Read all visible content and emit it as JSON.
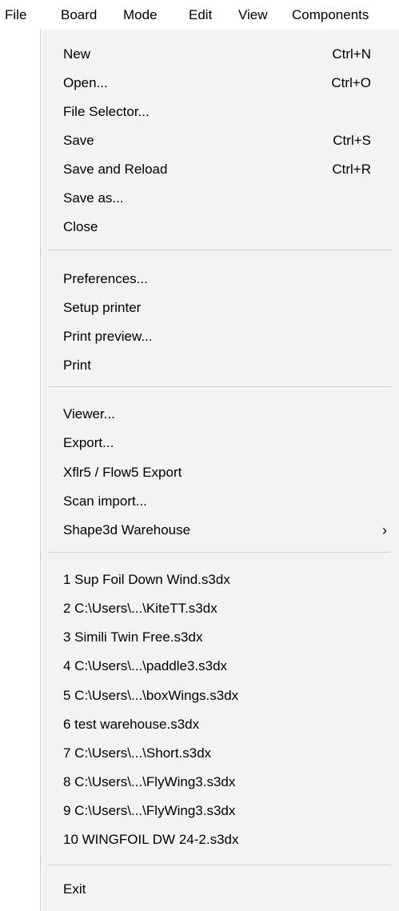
{
  "menubar": {
    "items": [
      "File",
      "Board",
      "Mode",
      "Edit",
      "View",
      "Components"
    ]
  },
  "file_menu": {
    "group1": [
      {
        "label": "New",
        "shortcut": "Ctrl+N"
      },
      {
        "label": "Open...",
        "shortcut": "Ctrl+O"
      },
      {
        "label": "File Selector...",
        "shortcut": ""
      },
      {
        "label": "Save",
        "shortcut": "Ctrl+S"
      },
      {
        "label": "Save and Reload",
        "shortcut": "Ctrl+R"
      },
      {
        "label": "Save as...",
        "shortcut": ""
      },
      {
        "label": "Close",
        "shortcut": ""
      }
    ],
    "group2": [
      {
        "label": "Preferences..."
      },
      {
        "label": "Setup printer"
      },
      {
        "label": "Print preview..."
      },
      {
        "label": "Print"
      }
    ],
    "group3": [
      {
        "label": "Viewer..."
      },
      {
        "label": "Export..."
      },
      {
        "label": "Xflr5 / Flow5 Export"
      },
      {
        "label": "Scan import..."
      },
      {
        "label": "Shape3d Warehouse",
        "submenu_arrow": "›"
      }
    ],
    "recent_files": [
      "1 Sup Foil Down Wind.s3dx",
      "2 C:\\Users\\...\\KiteTT.s3dx",
      "3 Simili Twin Free.s3dx",
      "4 C:\\Users\\...\\paddle3.s3dx",
      "5 C:\\Users\\...\\boxWings.s3dx",
      "6 test warehouse.s3dx",
      "7 C:\\Users\\...\\Short.s3dx",
      "8 C:\\Users\\...\\FlyWing3.s3dx",
      "9 C:\\Users\\...\\FlyWing3.s3dx",
      "10 WINGFOIL DW 24-2.s3dx"
    ],
    "exit": {
      "label": "Exit"
    }
  }
}
